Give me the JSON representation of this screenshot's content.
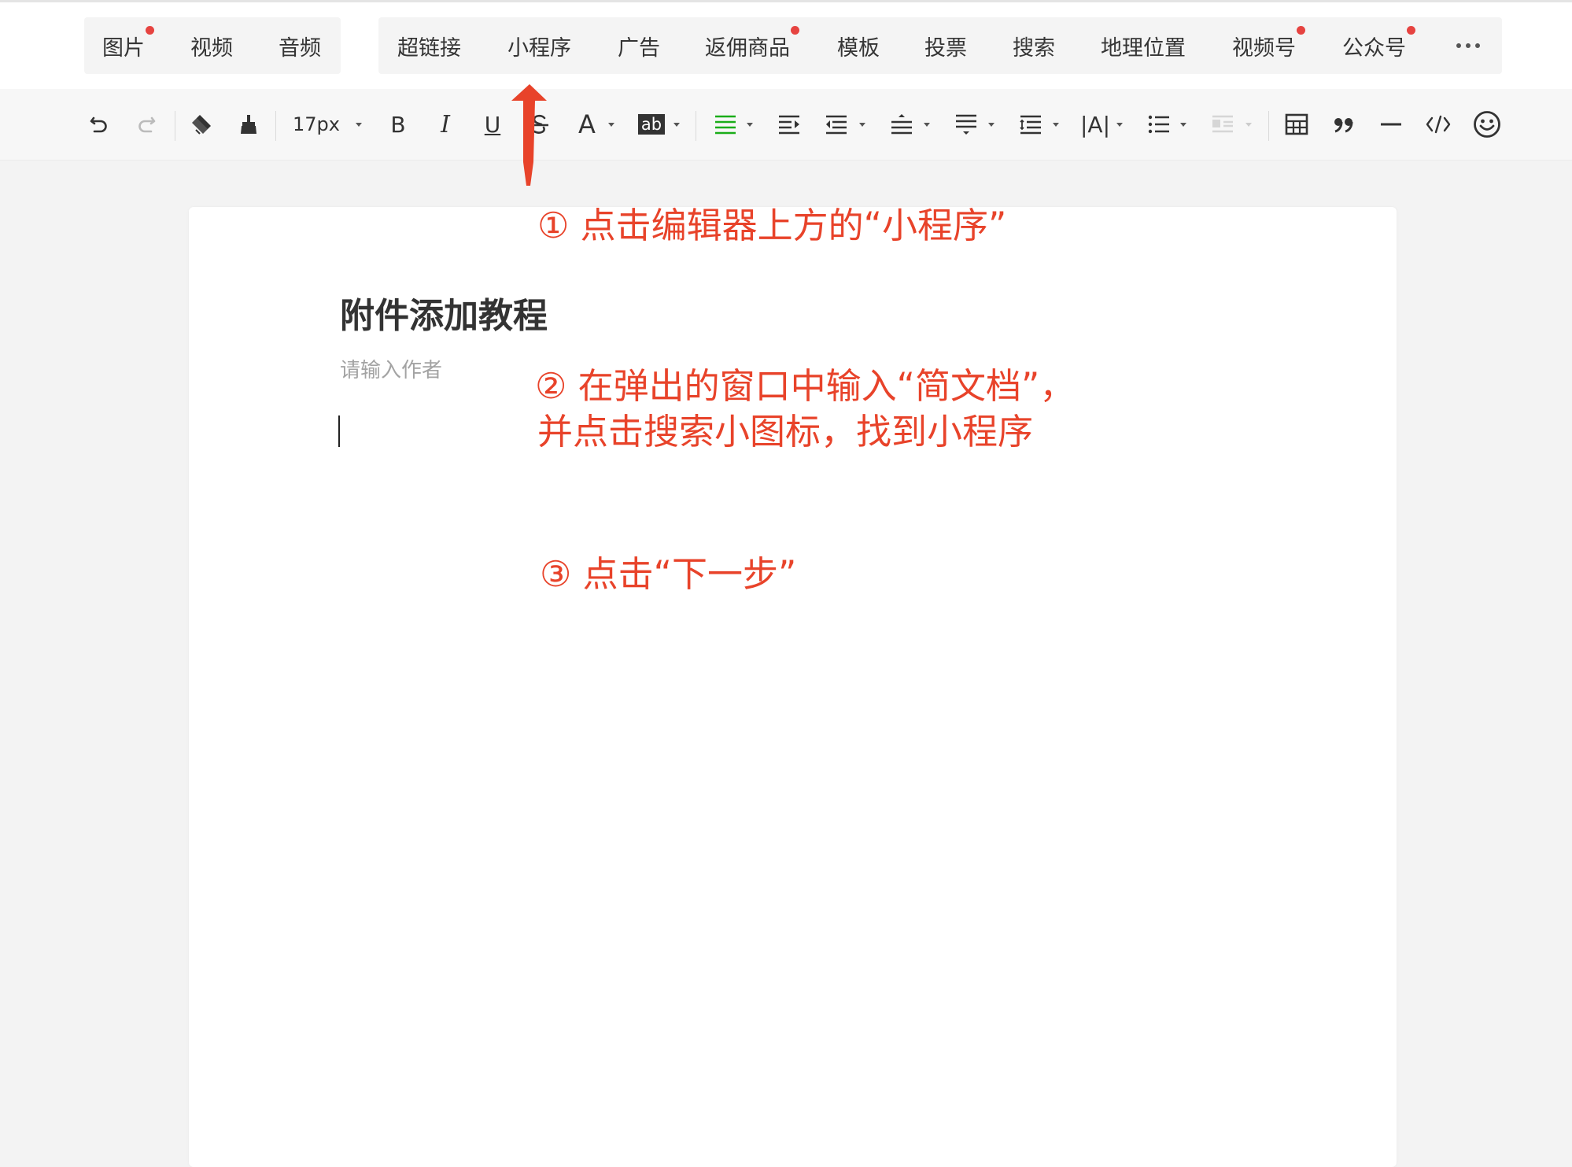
{
  "menubar": {
    "group1": [
      {
        "label": "图片",
        "dot": true
      },
      {
        "label": "视频",
        "dot": false
      },
      {
        "label": "音频",
        "dot": false
      }
    ],
    "group2": [
      {
        "label": "超链接",
        "dot": false
      },
      {
        "label": "小程序",
        "dot": false
      },
      {
        "label": "广告",
        "dot": false
      },
      {
        "label": "返佣商品",
        "dot": true
      },
      {
        "label": "模板",
        "dot": false
      },
      {
        "label": "投票",
        "dot": false
      },
      {
        "label": "搜索",
        "dot": false
      },
      {
        "label": "地理位置",
        "dot": false
      },
      {
        "label": "视频号",
        "dot": true
      },
      {
        "label": "公众号",
        "dot": true
      }
    ]
  },
  "toolbar": {
    "font_size": "17px",
    "bold": "B",
    "italic": "I",
    "underline": "U",
    "font_color": "A",
    "bg_color": "ab",
    "letter_spacing": "|A|"
  },
  "editor": {
    "title": "附件添加教程",
    "author_placeholder": "请输入作者"
  },
  "annotations": {
    "step1": "① 点击编辑器上方的“小程序”",
    "step2_line1": "② 在弹出的窗口中输入“简文档”，",
    "step2_line2": "并点击搜索小图标，找到小程序",
    "step3": "③ 点击“下一步”"
  },
  "colors": {
    "annotation_red": "#e8432a",
    "notification_dot": "#e64340",
    "align_active": "#1aad19"
  }
}
